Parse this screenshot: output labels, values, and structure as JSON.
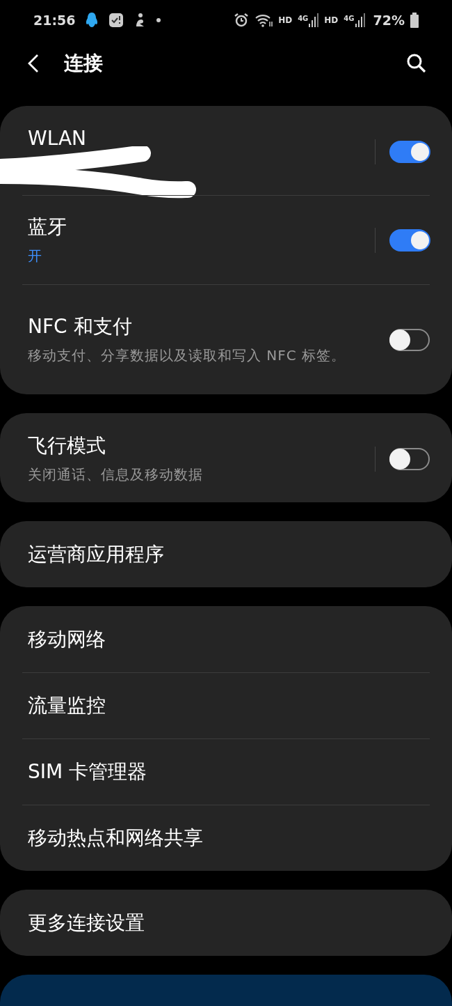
{
  "status_bar": {
    "time": "21:56",
    "network": [
      {
        "hd": "HD",
        "gen": "4G"
      },
      {
        "hd": "HD",
        "gen": "4G"
      }
    ],
    "battery": "72%"
  },
  "header": {
    "title": "连接"
  },
  "groups": [
    {
      "items": [
        {
          "kind": "toggle",
          "title": "WLAN",
          "on": true,
          "split": true,
          "redacted": true
        },
        {
          "kind": "toggle",
          "title": "蓝牙",
          "subtitle": "开",
          "subtitle_accent": true,
          "on": true,
          "split": true
        },
        {
          "kind": "toggle",
          "title": "NFC 和支付",
          "subtitle": "移动支付、分享数据以及读取和写入 NFC 标签。",
          "subtitle_accent": false,
          "on": false,
          "split": false
        }
      ]
    },
    {
      "items": [
        {
          "kind": "toggle",
          "title": "飞行模式",
          "subtitle": "关闭通话、信息及移动数据",
          "subtitle_accent": false,
          "on": false,
          "split": true
        }
      ]
    },
    {
      "items": [
        {
          "kind": "link",
          "title": "运营商应用程序"
        }
      ]
    },
    {
      "items": [
        {
          "kind": "link",
          "title": "移动网络"
        },
        {
          "kind": "link",
          "title": "流量监控"
        },
        {
          "kind": "link",
          "title": "SIM 卡管理器"
        },
        {
          "kind": "link",
          "title": "移动热点和网络共享"
        }
      ]
    },
    {
      "items": [
        {
          "kind": "link",
          "title": "更多连接设置"
        }
      ]
    },
    {
      "kind": "promo"
    }
  ]
}
